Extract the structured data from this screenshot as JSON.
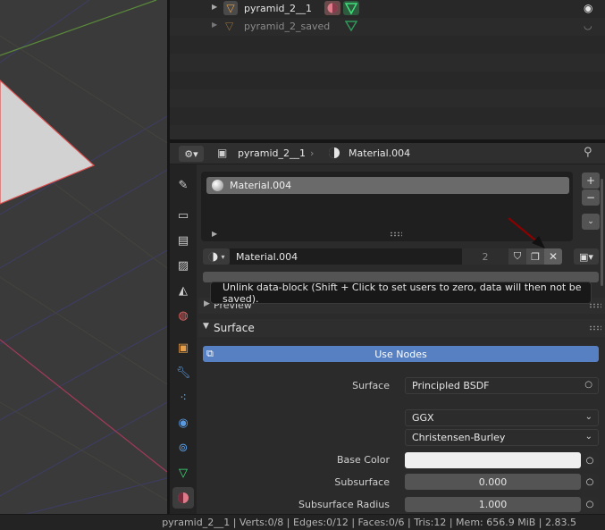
{
  "outliner": {
    "rows": [
      {
        "label": "pyramid_2__1"
      },
      {
        "label": "pyramid_2_saved"
      }
    ]
  },
  "header": {
    "object_name": "pyramid_2__1",
    "material_name": "Material.004"
  },
  "material_slots": {
    "items": [
      "Material.004"
    ],
    "add_label": "+",
    "remove_label": "−"
  },
  "datablock": {
    "name": "Material.004",
    "users": "2"
  },
  "tooltip": {
    "text": "Unlink data-block (Shift + Click to set users to zero, data will then not be saved)."
  },
  "panels": {
    "preview_label": "Preview",
    "surface_label": "Surface"
  },
  "surface": {
    "use_nodes_label": "Use Nodes",
    "surface_label": "Surface",
    "surface_value": "Principled BSDF",
    "distribution_value": "GGX",
    "subsurface_method_value": "Christensen-Burley",
    "base_color_label": "Base Color",
    "subsurface_label": "Subsurface",
    "subsurface_value": "0.000",
    "subsurface_radius_label": "Subsurface Radius",
    "subsurface_radius_value": "1.000",
    "base_color_hex": "#f0f0f0"
  },
  "status": {
    "text": "pyramid_2__1 | Verts:0/8 | Edges:0/12 | Faces:0/6 | Tris:12 | Mem: 656.9 MiB | 2.83.5"
  },
  "colors": {
    "accent": "#5680c2",
    "object_orange": "#e59f4b",
    "mesh_green": "#3ee07a"
  }
}
